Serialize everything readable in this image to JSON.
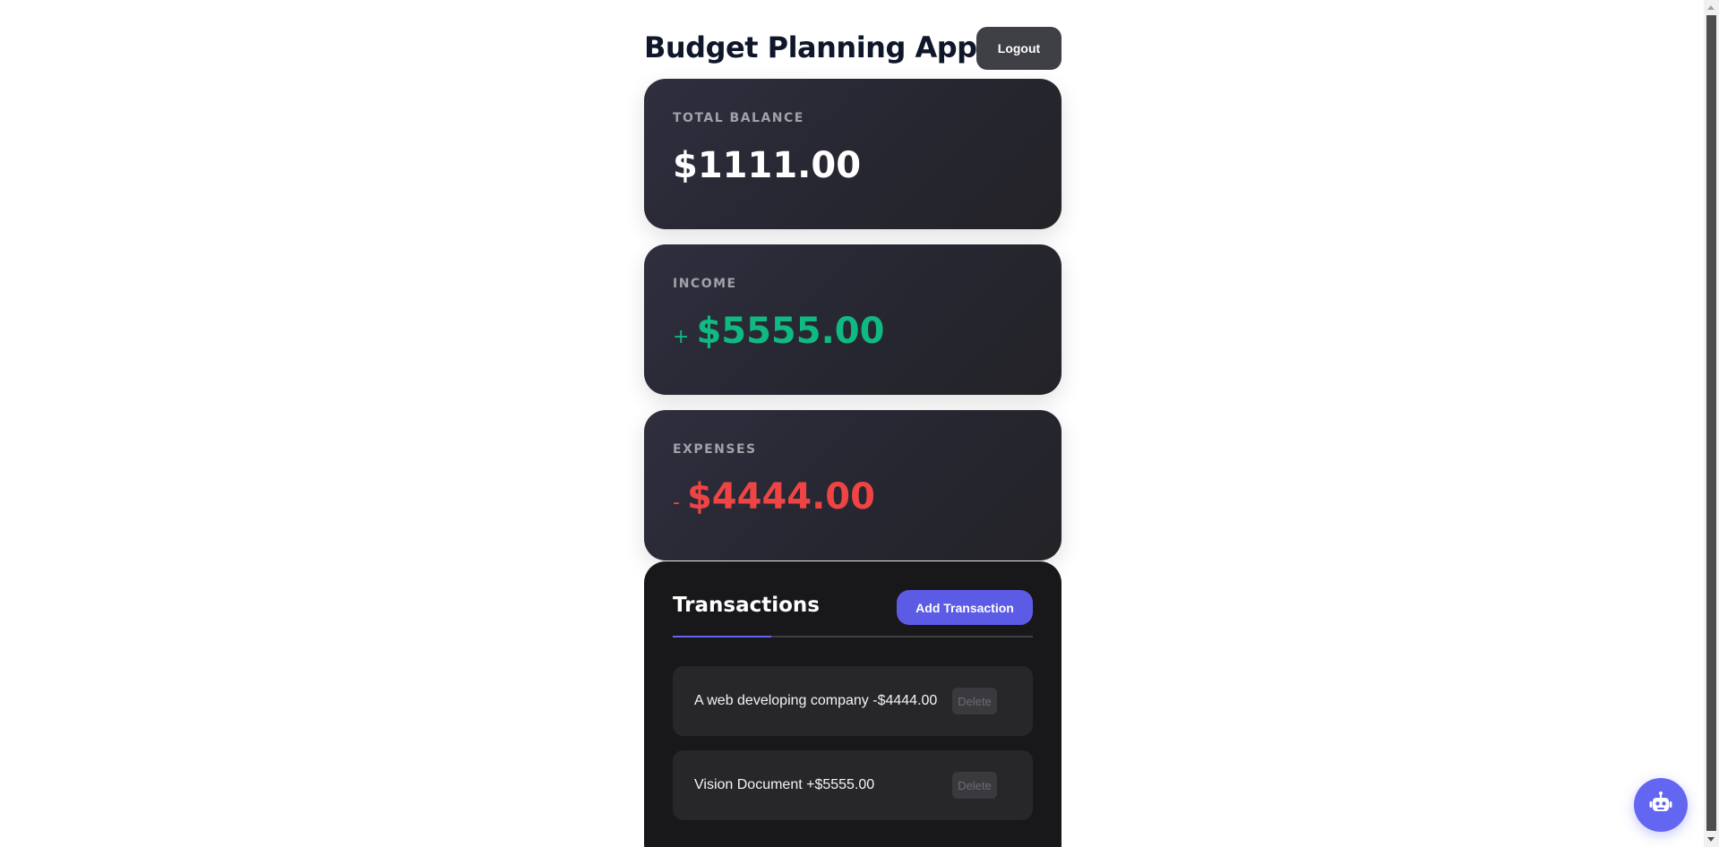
{
  "header": {
    "title": "Budget Planning App",
    "logout_label": "Logout"
  },
  "summary": {
    "balance": {
      "label": "TOTAL BALANCE",
      "amount": "$1111.00"
    },
    "income": {
      "label": "INCOME",
      "sign": "+",
      "amount": "$5555.00",
      "color": "#10b981"
    },
    "expenses": {
      "label": "EXPENSES",
      "sign": "-",
      "amount": "$4444.00",
      "color": "#ef4444"
    }
  },
  "transactions": {
    "title": "Transactions",
    "add_label": "Add Transaction",
    "items": [
      {
        "text": "A web developing company -$4444.00",
        "delete_label": "Delete"
      },
      {
        "text": "Vision Document +$5555.00",
        "delete_label": "Delete"
      }
    ]
  },
  "assistant": {
    "icon": "robot-icon"
  },
  "colors": {
    "accent": "#6366f1",
    "card_bg": "#2a2a36",
    "panel_bg": "#18181b"
  }
}
